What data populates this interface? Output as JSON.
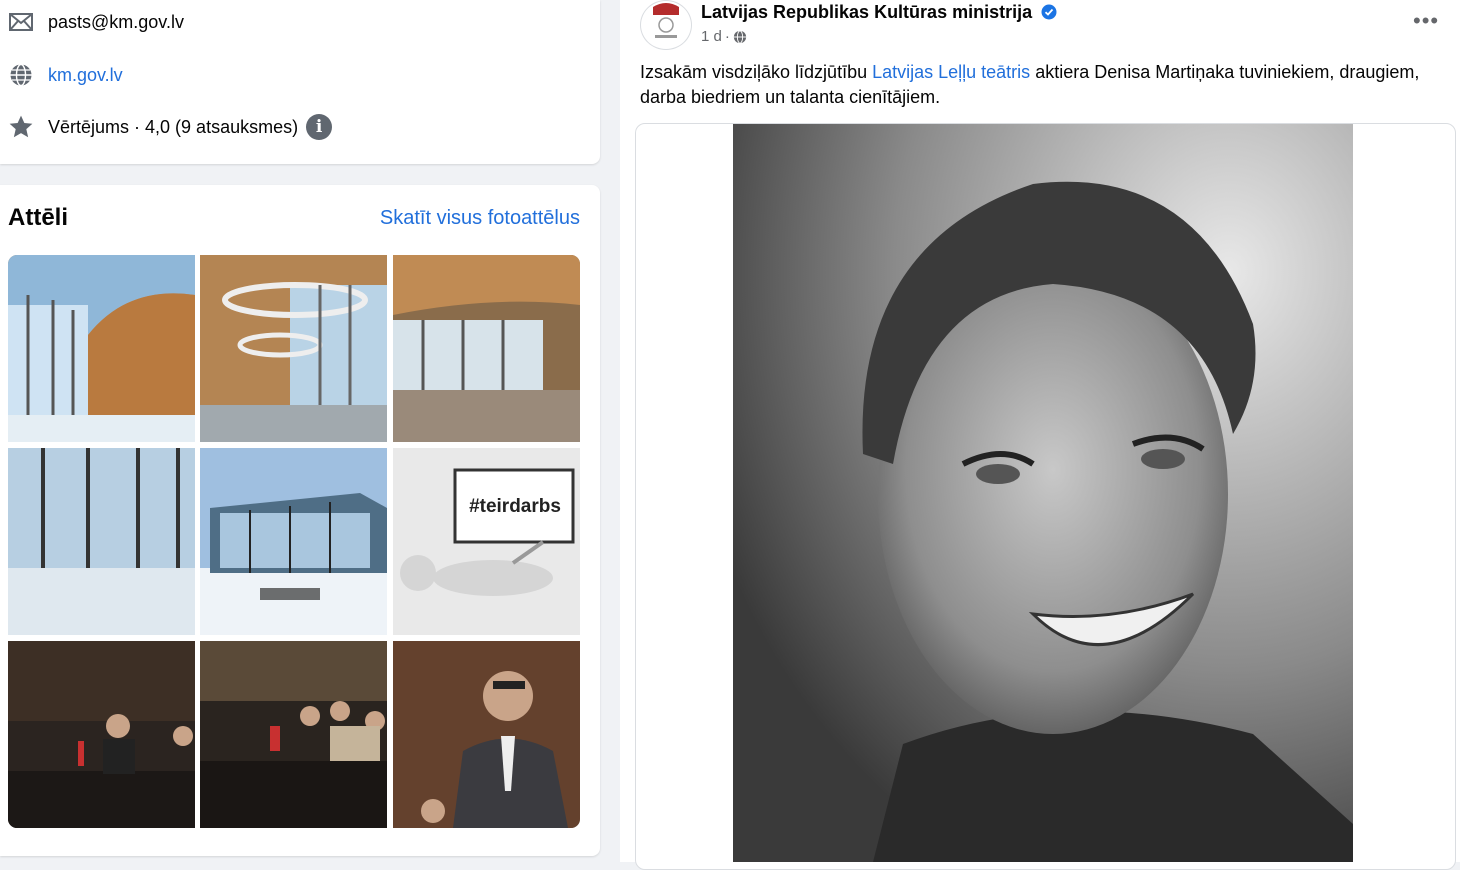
{
  "contact": {
    "email": "pasts@km.gov.lv",
    "website": "km.gov.lv",
    "rating_text": "Vērtējums · 4,0 (9 atsauksmes)"
  },
  "photos": {
    "title": "Attēli",
    "see_all": "Skatīt visus fotoattēlus",
    "tiles": [
      {
        "label": "",
        "description": "glass pavilion interior with wood curved wall"
      },
      {
        "label": "",
        "description": "curved ceiling light interior"
      },
      {
        "label": "",
        "description": "empty hall with windows"
      },
      {
        "label": "",
        "description": "glass facade in snow"
      },
      {
        "label": "",
        "description": "glass pavilion exterior winter"
      },
      {
        "label": "#teirdarbs",
        "description": "3d figure with sign"
      },
      {
        "label": "",
        "description": "meeting at table"
      },
      {
        "label": "",
        "description": "meeting room with flags"
      },
      {
        "label": "",
        "description": "man speaking in suit"
      }
    ]
  },
  "post": {
    "page_name": "Latvijas Republikas Kultūras ministrija",
    "time": "1 d",
    "text_before": "Izsakām visdziļāko līdzjūtību ",
    "text_link": "Latvijas Leļļu teātris",
    "text_after": " aktiera Denisa Martiņaka tuviniekiem, draugiem, darba biedriem un talanta cienītājiem."
  },
  "colors": {
    "link": "#216fdb",
    "background": "#f0f2f5",
    "verified": "#1b74e4",
    "muted_icon": "#606770"
  },
  "icons": [
    "envelope-icon",
    "globe-icon",
    "star-icon",
    "info-icon",
    "verified-icon",
    "globe-small-icon",
    "more-icon"
  ]
}
